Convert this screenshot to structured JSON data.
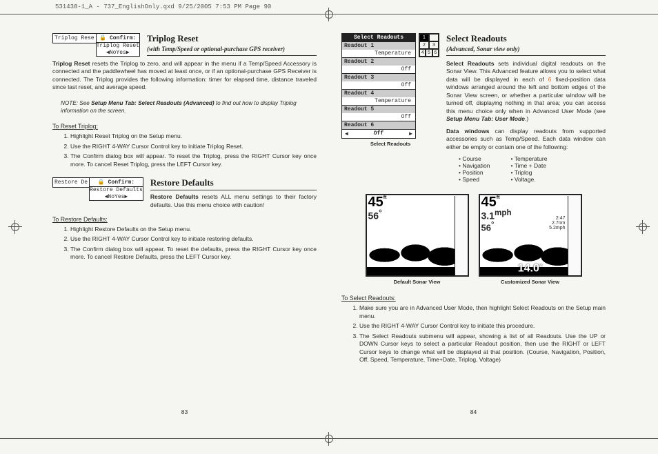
{
  "slug": "531438-1_A - 737_EnglishOnly.qxd  9/25/2005  7:53 PM  Page 90",
  "left": {
    "triplog": {
      "heading": "Triplog Reset",
      "sub": "(with Temp/Speed or optional-purchase GPS receiver)",
      "confirm": {
        "title": "🔒 Confirm:",
        "line": "Triplog Reset",
        "no": "◀No",
        "yes": "Yes▶",
        "strip": "Triplog Rese"
      },
      "body": "Triplog Reset resets the Triplog to zero, and will appear in the menu if a Temp/Speed Accessory is connected and the paddlewheel has moved at least once, or if an optional-purchase GPS Receiver is connected. The Triplog provides the following information: timer for elapsed time, distance traveled since last reset, and average speed.",
      "note_pre": "NOTE:  See ",
      "note_bold": "Setup Menu Tab: Select Readouts (Advanced)",
      "note_post": " to find out how to display Triplog information on the screen.",
      "steps_title": "To Reset Triplog:",
      "s1": "Highlight Reset Triplog on the Setup menu.",
      "s2": "Use the RIGHT 4-WAY Cursor Control key to initiate Triplog Reset.",
      "s3": "The Confirm dialog box will appear. To reset the Triplog, press the RIGHT Cursor key once more. To cancel Reset Triplog, press the LEFT Cursor key."
    },
    "restore": {
      "heading": "Restore Defaults",
      "confirm": {
        "title": "🔒 Confirm:",
        "line": "Restore Defaults",
        "no": "◀No",
        "yes": "Yes▶",
        "strip": "Restore De"
      },
      "body_bold": "Restore Defaults",
      "body": " resets ALL menu settings to their factory defaults. Use this menu choice with caution!",
      "steps_title": "To Restore Defaults:",
      "s1": "Highlight Restore Defaults on the Setup menu.",
      "s2": "Use the RIGHT 4-WAY Cursor Control key to initiate restoring defaults.",
      "s3": "The Confirm dialog box will appear. To reset the defaults,  press the RIGHT Cursor key once more. To cancel Restore Defaults, press the LEFT Cursor key."
    },
    "pagenum": "83"
  },
  "right": {
    "heading": "Select Readouts",
    "sub": "(Advanced, Sonar view only)",
    "fig": {
      "title": "Select Readouts",
      "r1h": "Readout 1",
      "r1v": "Temperature",
      "r2h": "Readout 2",
      "r2v": "Off",
      "r3h": "Readout 3",
      "r3v": "Off",
      "r4h": "Readout 4",
      "r4v": "Temperature",
      "r5h": "Readout 5",
      "r5v": "Off",
      "r6h": "Readout 6",
      "bot": "Off",
      "caption": "Select Readouts"
    },
    "p1a": "Select Readouts",
    "p1b": " sets individual digital readouts on the Sonar View. This Advanced feature allows you to select what data will be displayed in each of ",
    "p1c": "6",
    "p1d": " fixed-position data windows arranged around the left and bottom edges of the Sonar View screen, or whether a particular window will be turned off, displaying nothing in that area; you can access this menu choice only when in Advanced User Mode (see ",
    "p1e": "Setup Menu Tab: User Mode",
    "p1f": ".)",
    "p2a": "Data windows",
    "p2b": " can display readouts from supported accessories such as Temp/Speed. Each data window can either be empty or contain one of the following:",
    "bulletsL": [
      "Course",
      "Navigation",
      "Position",
      "Speed"
    ],
    "bulletsR": [
      "Temperature",
      "Time + Date",
      "Triplog",
      "Voltage."
    ],
    "sonar1": {
      "d": "45",
      "du": "ft",
      "s1": "56",
      "s1u": "°",
      "cap": "Default Sonar View"
    },
    "sonar2": {
      "d": "45",
      "du": "ft",
      "s1": "3.1",
      "s1u": "mph",
      "s2": "56",
      "s2u": "°",
      "bot": "14.0",
      "botu": "v",
      "tr1": "2:47",
      "tr2": "2.7nm",
      "tr3": "5.2mph",
      "cap": "Customized Sonar View"
    },
    "steps_title": "To Select Readouts:",
    "s1": "Make sure you are in Advanced User Mode, then highlight Select Readouts on the Setup main menu.",
    "s2": "Use the RIGHT 4-WAY Cursor Control key to initiate this procedure.",
    "s3": "The Select Readouts submenu will appear, showing a list of all Readouts. Use the UP or DOWN Cursor keys to select a particular Readout position, then use the RIGHT or LEFT Cursor keys to change what will be displayed at that position. (Course, Navigation, Position, Off, Speed, Temperature, Time+Date, Triplog, Voltage)",
    "pagenum": "84"
  }
}
